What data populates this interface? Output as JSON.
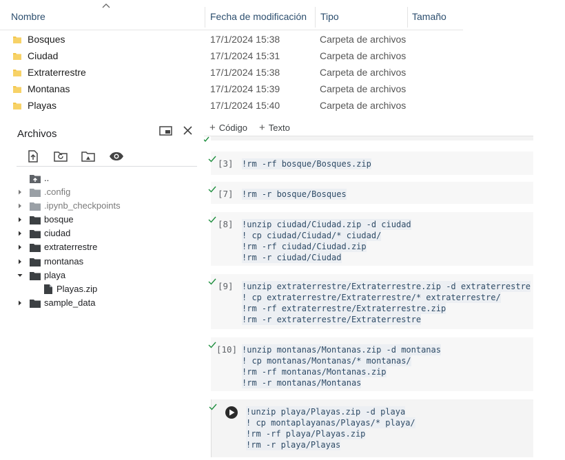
{
  "explorer": {
    "columns": {
      "name": "Nombre",
      "modified": "Fecha de modificación",
      "type": "Tipo",
      "size": "Tamaño"
    },
    "rows": [
      {
        "name": "Bosques",
        "modified": "17/1/2024 15:38",
        "type": "Carpeta de archivos"
      },
      {
        "name": "Ciudad",
        "modified": "17/1/2024 15:31",
        "type": "Carpeta de archivos"
      },
      {
        "name": "Extraterrestre",
        "modified": "17/1/2024 15:38",
        "type": "Carpeta de archivos"
      },
      {
        "name": "Montanas",
        "modified": "17/1/2024 15:39",
        "type": "Carpeta de archivos"
      },
      {
        "name": "Playas",
        "modified": "17/1/2024 15:40",
        "type": "Carpeta de archivos"
      }
    ]
  },
  "toolbar": {
    "code_label": "Código",
    "text_label": "Texto"
  },
  "sidebar": {
    "title": "Archivos",
    "tree": [
      {
        "label": "..",
        "kind": "up"
      },
      {
        "label": ".config",
        "kind": "folder",
        "dim": true
      },
      {
        "label": ".ipynb_checkpoints",
        "kind": "folder",
        "dim": true
      },
      {
        "label": "bosque",
        "kind": "folder"
      },
      {
        "label": "ciudad",
        "kind": "folder"
      },
      {
        "label": "extraterrestre",
        "kind": "folder"
      },
      {
        "label": "montanas",
        "kind": "folder"
      },
      {
        "label": "playa",
        "kind": "folder-open"
      },
      {
        "label": "Playas.zip",
        "kind": "file"
      },
      {
        "label": "sample_data",
        "kind": "folder"
      }
    ]
  },
  "cells": [
    {
      "exec": "[3]",
      "lines": [
        "!rm -rf bosque/Bosques.zip"
      ]
    },
    {
      "exec": "[7]",
      "lines": [
        "!rm -r bosque/Bosques"
      ]
    },
    {
      "exec": "[8]",
      "lines": [
        "!unzip ciudad/Ciudad.zip -d ciudad",
        "! cp ciudad/Ciudad/* ciudad/",
        "!rm -rf ciudad/Ciudad.zip",
        "!rm -r ciudad/Ciudad"
      ]
    },
    {
      "exec": "[9]",
      "lines": [
        "!unzip extraterrestre/Extraterrestre.zip -d extraterrestre",
        "! cp extraterrestre/Extraterrestre/* extraterrestre/",
        "!rm -rf extraterrestre/Extraterrestre.zip",
        "!rm -r extraterrestre/Extraterrestre"
      ]
    },
    {
      "exec": "[10]",
      "lines": [
        "!unzip montanas/Montanas.zip -d montanas",
        "! cp montanas/Montanas/* montanas/",
        "!rm -rf montanas/Montanas.zip",
        "!rm -r montanas/Montanas"
      ]
    },
    {
      "exec": "",
      "lines": [
        "!unzip playa/Playas.zip -d playa",
        "! cp montaplayanas/Playas/* playa/",
        "!rm -rf playa/Playas.zip",
        "!rm -r playa/Playas"
      ]
    }
  ],
  "colors": {
    "folder_yellow": "#f3c64b",
    "check_green": "#1e8e3e",
    "code_text": "#2e4b66"
  }
}
